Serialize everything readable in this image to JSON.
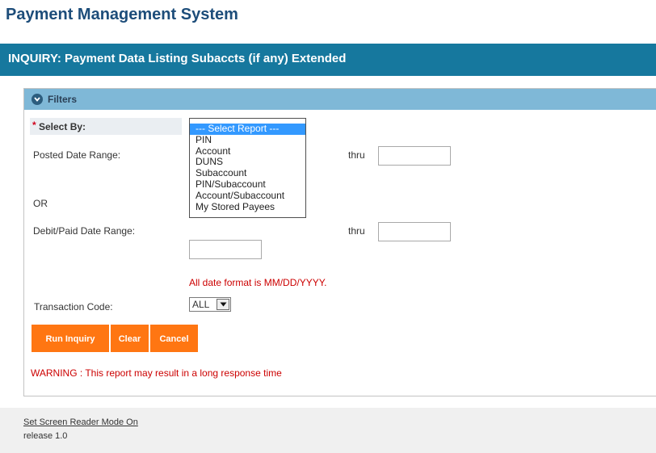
{
  "app": {
    "title": "Payment Management System"
  },
  "page": {
    "header": "INQUIRY: Payment Data Listing Subaccts (if any) Extended"
  },
  "filters": {
    "panel_label": "Filters",
    "required_marker": "*",
    "select_by_label": "Select By:",
    "select_by_options": [
      "--- Select Report ---",
      "PIN",
      "Account",
      "DUNS",
      "Subaccount",
      "PIN/Subaccount",
      "Account/Subaccount",
      "My Stored Payees"
    ],
    "select_by_selected": "--- Select Report ---",
    "posted_date_label": "Posted Date Range:",
    "posted_thru_label": "thru",
    "posted_to_value": "",
    "or_label": "OR",
    "debit_paid_label": "Debit/Paid Date Range:",
    "debit_thru_label": "thru",
    "debit_from_value": "",
    "debit_to_value": "",
    "date_format_note": "All date format is MM/DD/YYYY.",
    "transaction_code_label": "Transaction Code:",
    "transaction_code_value": "ALL",
    "buttons": {
      "run": "Run Inquiry",
      "clear": "Clear",
      "cancel": "Cancel"
    },
    "warning": "WARNING : This report may result in a long response time"
  },
  "footer": {
    "screen_reader_link": "Set Screen Reader Mode On",
    "release": "release 1.0"
  },
  "colors": {
    "header_bar": "#16789e",
    "filter_bar": "#7fb8d7",
    "button": "#ff7612",
    "warning_text": "#cc0000",
    "title_text": "#1d4d7a"
  }
}
